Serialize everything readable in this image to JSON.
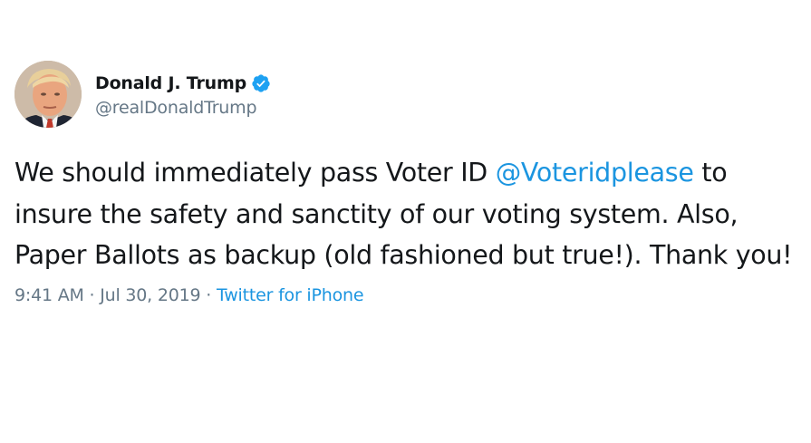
{
  "author": {
    "display_name": "Donald J. Trump",
    "handle": "@realDonaldTrump",
    "verified": true,
    "verified_icon": "verified-badge-icon",
    "avatar_icon": "profile-photo"
  },
  "tweet": {
    "text_before": "We should immediately pass Voter ID ",
    "mention": "@Voteridplease",
    "text_after": " to insure the safety and sanctity of our voting system. Also, Paper Ballots as backup (old fashioned but true!). Thank you!"
  },
  "meta": {
    "time": "9:41 AM",
    "separator": " · ",
    "date": "Jul 30, 2019",
    "source": "Twitter for iPhone"
  },
  "colors": {
    "text": "#14171a",
    "secondary": "#657786",
    "link": "#1b95e0",
    "verified": "#1da1f2"
  }
}
